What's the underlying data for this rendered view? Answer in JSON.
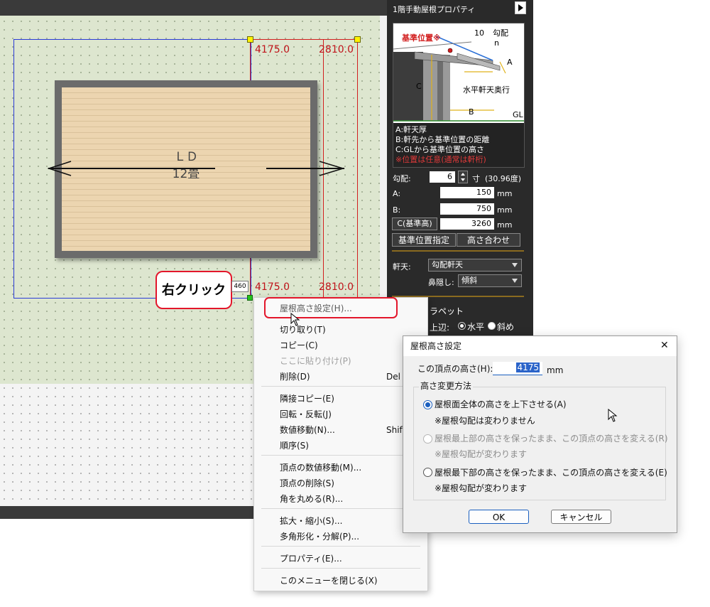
{
  "canvas": {
    "dim_top_left": "4175.0",
    "dim_top_right": "2810.0",
    "dim_bottom_left": "4175.0",
    "dim_bottom_right": "2810.0",
    "room_name": "ＬＤ",
    "room_size": "12畳",
    "callout": "右クリック",
    "vertex_tag": "460"
  },
  "panel": {
    "title": "1階手動屋根プロパティ",
    "diagram": {
      "ref_label": "基準位置※",
      "ten": "10",
      "pitch": "勾配",
      "n": "n",
      "a": "A",
      "c": "C",
      "b": "B",
      "eave_depth": "水平軒天奥行",
      "gl": "GL",
      "legend": [
        "A:軒天厚",
        "B:軒先から基準位置の距離",
        "C:GLから基準位置の高さ"
      ],
      "note": "※位置は任意(通常は軒桁)"
    },
    "pitch_label": "勾配:",
    "pitch_value": "6",
    "pitch_unit": "寸",
    "pitch_degree": "(30.96度)",
    "a_label": "A:",
    "a_value": "150",
    "b_label": "B:",
    "b_value": "750",
    "c_label": "C(基準高)",
    "c_value": "3260",
    "unit_mm": "mm",
    "btn_reference": "基準位置指定",
    "btn_height": "高さ合わせ",
    "eave_label": "軒天:",
    "eave_value": "勾配軒天",
    "nose_label": "鼻隠し:",
    "nose_value": "傾斜",
    "parapet_label": "ラペット",
    "upper_edge_label": "上辺:",
    "opt_horizontal": "水平",
    "opt_diagonal": "斜め"
  },
  "context_menu": {
    "items": [
      {
        "label": "屋根高さ設定(H)...",
        "shortcut": "",
        "disabled": false
      },
      {
        "label": "切り取り(T)",
        "shortcut": "",
        "disabled": false
      },
      {
        "label": "コピー(C)",
        "shortcut": "",
        "disabled": false
      },
      {
        "label": "ここに貼り付け(P)",
        "shortcut": "",
        "disabled": true
      },
      {
        "label": "削除(D)",
        "shortcut": "Del",
        "disabled": false
      },
      {
        "label": "隣接コピー(E)",
        "shortcut": "",
        "disabled": false
      },
      {
        "label": "回転・反転(J)",
        "shortcut": "",
        "disabled": false
      },
      {
        "label": "数値移動(N)...",
        "shortcut": "Shift",
        "disabled": false
      },
      {
        "label": "順序(S)",
        "shortcut": "",
        "disabled": false
      },
      {
        "label": "頂点の数値移動(M)...",
        "shortcut": "",
        "disabled": false
      },
      {
        "label": "頂点の削除(S)",
        "shortcut": "",
        "disabled": false
      },
      {
        "label": "角を丸める(R)...",
        "shortcut": "",
        "disabled": false
      },
      {
        "label": "拡大・縮小(S)...",
        "shortcut": "",
        "disabled": false
      },
      {
        "label": "多角形化・分解(P)...",
        "shortcut": "",
        "disabled": false
      },
      {
        "label": "プロパティ(E)...",
        "shortcut": "",
        "disabled": false
      },
      {
        "label": "このメニューを閉じる(X)",
        "shortcut": "",
        "disabled": false
      }
    ]
  },
  "dialog": {
    "title": "屋根高さ設定",
    "close": "✕",
    "vertex_height_label": "この頂点の高さ(H):",
    "vertex_height_value": "4175",
    "unit": "mm",
    "group_title": "高さ変更方法",
    "options": [
      {
        "label": "屋根面全体の高さを上下させる(A)",
        "note": "※屋根勾配は変わりません",
        "selected": true,
        "disabled": false
      },
      {
        "label": "屋根最上部の高さを保ったまま、この頂点の高さを変える(R)",
        "note": "※屋根勾配が変わります",
        "selected": false,
        "disabled": true
      },
      {
        "label": "屋根最下部の高さを保ったまま、この頂点の高さを変える(E)",
        "note": "※屋根勾配が変わります",
        "selected": false,
        "disabled": false
      }
    ],
    "ok": "OK",
    "cancel": "キャンセル"
  }
}
